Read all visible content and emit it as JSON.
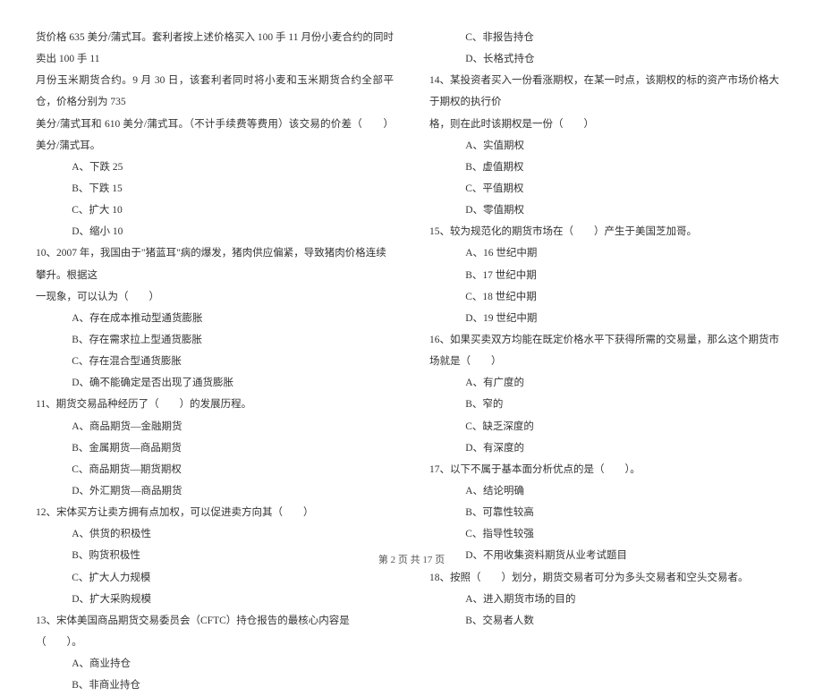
{
  "left": {
    "intro": [
      "货价格 635 美分/蒲式耳。套利者按上述价格买入 100 手 11 月份小麦合约的同时卖出 100 手 11",
      "月份玉米期货合约。9 月 30 日，该套利者同时将小麦和玉米期货合约全部平仓，价格分别为 735",
      "美分/蒲式耳和 610 美分/蒲式耳。（不计手续费等费用）该交易的价差（　　）美分/蒲式耳。"
    ],
    "q9opts": [
      "A、下跌 25",
      "B、下跌 15",
      "C、扩大 10",
      "D、缩小 10"
    ],
    "q10": "10、2007 年，我国由于\"猪蓝耳\"病的爆发，猪肉供应偏紧，导致猪肉价格连续攀升。根据这",
    "q10b": "一现象，可以认为（　　）",
    "q10opts": [
      "A、存在成本推动型通货膨胀",
      "B、存在需求拉上型通货膨胀",
      "C、存在混合型通货膨胀",
      "D、确不能确定是否出现了通货膨胀"
    ],
    "q11": "11、期货交易品种经历了（　　）的发展历程。",
    "q11opts": [
      "A、商品期货—金融期货",
      "B、金属期货—商品期货",
      "C、商品期货—期货期权",
      "D、外汇期货—商品期货"
    ],
    "q12": "12、宋体买方让卖方拥有点加权，可以促进卖方向其（　　）",
    "q12opts": [
      "A、供货的积极性",
      "B、购货积极性",
      "C、扩大人力规模",
      "D、扩大采购规模"
    ],
    "q13": "13、宋体美国商品期货交易委员会（CFTC）持仓报告的最核心内容是（　　）。",
    "q13opts": [
      "A、商业持仓",
      "B、非商业持仓"
    ]
  },
  "right": {
    "q13opts": [
      "C、非报告持仓",
      "D、长格式持仓"
    ],
    "q14": "14、某投资者买入一份看涨期权，在某一时点，该期权的标的资产市场价格大于期权的执行价",
    "q14b": "格，则在此时该期权是一份（　　）",
    "q14opts": [
      "A、实值期权",
      "B、虚值期权",
      "C、平值期权",
      "D、零值期权"
    ],
    "q15": "15、较为规范化的期货市场在（　　）产生于美国芝加哥。",
    "q15opts": [
      "A、16 世纪中期",
      "B、17 世纪中期",
      "C、18 世纪中期",
      "D、19 世纪中期"
    ],
    "q16": "16、如果买卖双方均能在既定价格水平下获得所需的交易量，那么这个期货市场就是（　　）",
    "q16opts": [
      "A、有广度的",
      "B、窄的",
      "C、缺乏深度的",
      "D、有深度的"
    ],
    "q17": "17、以下不属于基本面分析优点的是（　　）。",
    "q17opts": [
      "A、结论明确",
      "B、可靠性较高",
      "C、指导性较强",
      "D、不用收集资料期货从业考试题目"
    ],
    "q18": "18、按照（　　）划分，期货交易者可分为多头交易者和空头交易者。",
    "q18opts": [
      "A、进入期货市场的目的",
      "B、交易者人数"
    ]
  },
  "footer": "第 2 页 共 17 页"
}
